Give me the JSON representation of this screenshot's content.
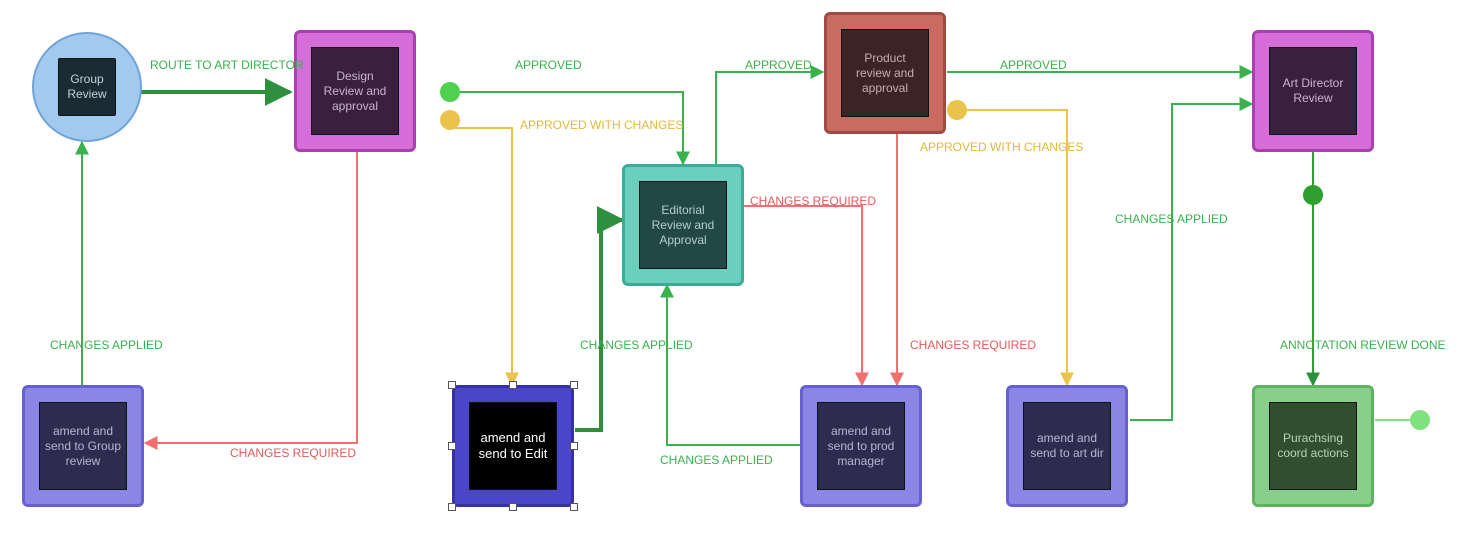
{
  "nodes": {
    "group_review": {
      "label": "Group Review"
    },
    "design_review": {
      "label": "Design Review and approval"
    },
    "editorial_review": {
      "label": "Editorial Review and Approval"
    },
    "product_review": {
      "label": "Product review and approval"
    },
    "art_director_review": {
      "label": "Art Director Review"
    },
    "amend_group": {
      "label": "amend and send to Group review"
    },
    "amend_edit": {
      "label": "amend and send to Edit"
    },
    "amend_prod": {
      "label": "amend and send to prod manager"
    },
    "amend_art": {
      "label": "amend and send to art dir"
    },
    "purchasing": {
      "label": "Purachsing coord actions"
    }
  },
  "edges": {
    "route_to_art_director": "ROUTE TO ART DIRECTOR",
    "approved_1": "APPROVED",
    "approved_2": "APPROVED",
    "approved_3": "APPROVED",
    "approved_changes_1": "APPROVED WITH CHANGES",
    "approved_changes_2": "APPROVED WITH CHANGES",
    "changes_required_1": "CHANGES REQUIRED",
    "changes_required_2": "CHANGES REQUIRED",
    "changes_required_3": "CHANGES REQUIRED",
    "changes_applied_1": "CHANGES APPLIED",
    "changes_applied_2": "CHANGES APPLIED",
    "changes_applied_3": "CHANGES APPLIED",
    "changes_applied_4": "CHANGES APPLIED",
    "annotation_done": "ANNOTATION REVIEW DONE"
  },
  "colors": {
    "green": "#3bb14e",
    "green_dark": "#2e8f3d",
    "yellow": "#e9c34c",
    "red": "#f07070",
    "dot_green_bright": "#4fd04f",
    "dot_green_dark": "#2f9f2f",
    "dot_lime": "#7fe27f"
  }
}
